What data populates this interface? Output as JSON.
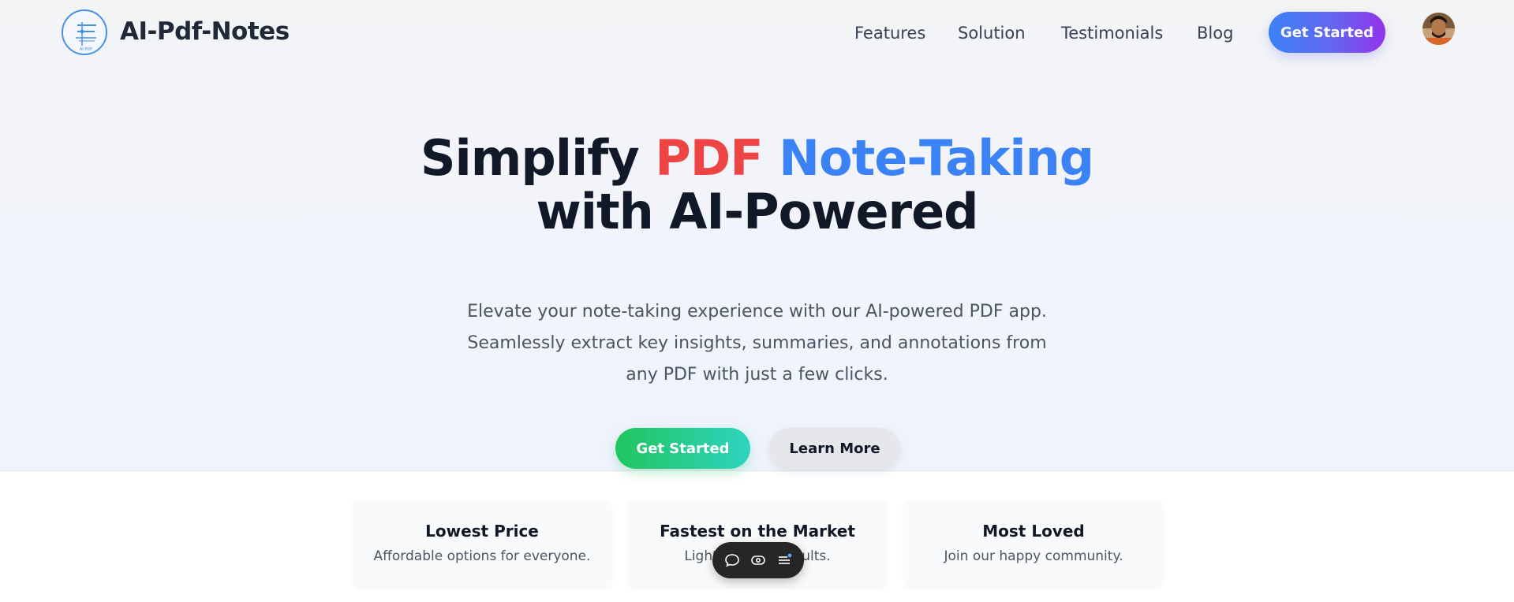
{
  "header": {
    "brand": "AI-Pdf-Notes",
    "logo_caption": "AI PDF",
    "nav": [
      {
        "label": "Features"
      },
      {
        "label": "Solution"
      },
      {
        "label": "Testimonials"
      },
      {
        "label": "Blog"
      }
    ],
    "cta_label": "Get Started",
    "avatar_icon": "user-avatar"
  },
  "hero": {
    "title_part1": "Simplify",
    "title_part2": "PDF",
    "title_part3": "Note-Taking",
    "title_line2": "with AI-Powered",
    "subtitle_line1": "Elevate your note-taking experience with our AI-powered PDF app.",
    "subtitle_line2": "Seamlessly extract key insights, summaries, and annotations from",
    "subtitle_line3": "any PDF with just a few clicks.",
    "primary_button": "Get Started",
    "secondary_button": "Learn More"
  },
  "features": [
    {
      "title": "Lowest Price",
      "description": "Affordable options for everyone."
    },
    {
      "title": "Fastest on the Market",
      "description": "Lightning-fast results."
    },
    {
      "title": "Most Loved",
      "description": "Join our happy community."
    }
  ],
  "floating_toolbar": {
    "icons": [
      "comment-icon",
      "toggle-eye-icon",
      "menu-notification-icon"
    ]
  },
  "colors": {
    "accent_red": "#ef4444",
    "accent_blue": "#3b82f6",
    "gradient_purple": "#9333ea",
    "gradient_green": "#22c55e"
  }
}
